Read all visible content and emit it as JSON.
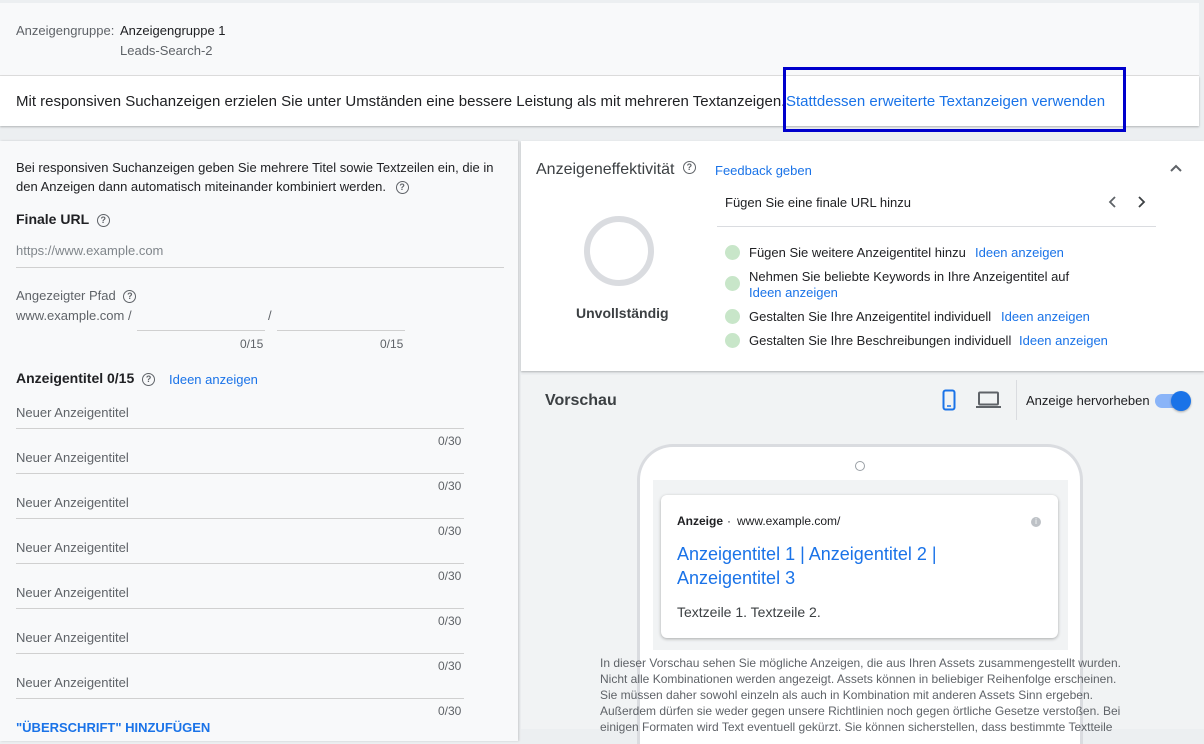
{
  "adgroup": {
    "label": "Anzeigengruppe:",
    "name": "Anzeigengruppe 1",
    "campaign": "Leads-Search-2"
  },
  "notice": {
    "text": "Mit responsiven Suchanzeigen erzielen Sie unter Umständen eine bessere Leistung als mit mehreren Textanzeigen.",
    "link": "Stattdessen erweiterte Textanzeigen verwenden"
  },
  "left": {
    "intro": "Bei responsiven Suchanzeigen geben Sie mehrere Titel sowie Textzeilen ein, die in den Anzeigen dann automatisch miteinander kombiniert werden.",
    "final_url_label": "Finale URL",
    "final_url_placeholder": "https://www.example.com",
    "path_label": "Angezeigter Pfad",
    "path_prefix": "www.example.com /",
    "path_sep": "/",
    "path1_counter": "0/15",
    "path2_counter": "0/15",
    "headlines_label": "Anzeigentitel 0/15",
    "ideas_link": "Ideen anzeigen",
    "headlines": [
      {
        "placeholder": "Neuer Anzeigentitel",
        "counter": "0/30"
      },
      {
        "placeholder": "Neuer Anzeigentitel",
        "counter": "0/30"
      },
      {
        "placeholder": "Neuer Anzeigentitel",
        "counter": "0/30"
      },
      {
        "placeholder": "Neuer Anzeigentitel",
        "counter": "0/30"
      },
      {
        "placeholder": "Neuer Anzeigentitel",
        "counter": "0/30"
      },
      {
        "placeholder": "Neuer Anzeigentitel",
        "counter": "0/30"
      },
      {
        "placeholder": "Neuer Anzeigentitel",
        "counter": "0/30"
      }
    ],
    "add_heading": "\"ÜBERSCHRIFT\" HINZUFÜGEN"
  },
  "effectiveness": {
    "title": "Anzeigeneffektivität",
    "feedback": "Feedback geben",
    "status": "Unvollständig",
    "tip_main": "Fügen Sie eine finale URL hinzu",
    "tips": [
      {
        "text": "Fügen Sie weitere Anzeigentitel hinzu",
        "link": "Ideen anzeigen"
      },
      {
        "text": "Nehmen Sie beliebte Keywords in Ihre Anzeigentitel auf",
        "link": "Ideen anzeigen"
      },
      {
        "text": "Gestalten Sie Ihre Anzeigentitel individuell",
        "link": "Ideen anzeigen"
      },
      {
        "text": "Gestalten Sie Ihre Beschreibungen individuell",
        "link": "Ideen anzeigen"
      }
    ]
  },
  "preview": {
    "title": "Vorschau",
    "highlight_label": "Anzeige hervorheben",
    "highlight_on": true,
    "ad": {
      "badge": "Anzeige",
      "url": "www.example.com/",
      "headline_line1": "Anzeigentitel 1 | Anzeigentitel 2 |",
      "headline_line2": "Anzeigentitel 3",
      "description": "Textzeile 1. Textzeile 2."
    },
    "note": "In dieser Vorschau sehen Sie mögliche Anzeigen, die aus Ihren Assets zusammengestellt wurden. Nicht alle Kombinationen werden angezeigt. Assets können in beliebiger Reihenfolge erscheinen. Sie müssen daher sowohl einzeln als auch in Kombination mit anderen Assets Sinn ergeben. Außerdem dürfen sie weder gegen unsere Richtlinien noch gegen örtliche Gesetze verstoßen. Bei einigen Formaten wird Text eventuell gekürzt. Sie können sicherstellen, dass bestimmte Textteile"
  },
  "colors": {
    "accent": "#1a73e8",
    "highlight_box": "#0000cc",
    "tip_dot": "#c8e6c9"
  }
}
